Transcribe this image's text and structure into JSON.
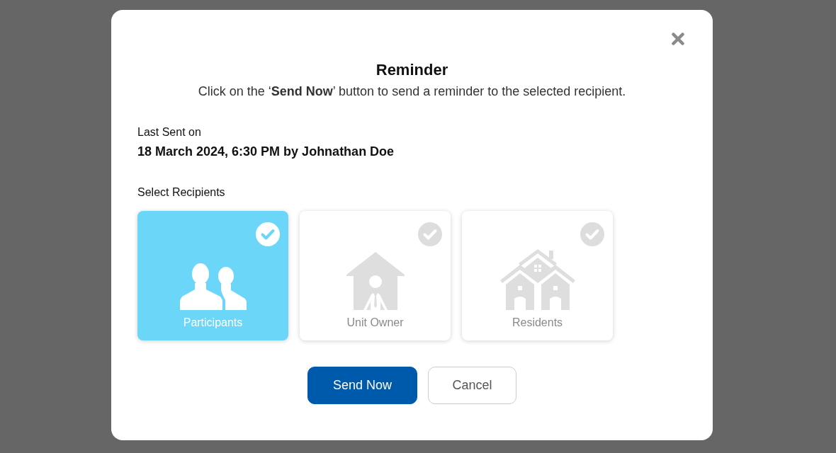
{
  "dialog": {
    "title": "Reminder",
    "instruction": "Click on the ‘**Send Now**’ button to send a reminder to the selected recipient.",
    "last_sent": {
      "label": "Last Sent on",
      "value": "18 March 2024, 6:30 PM by Johnathan Doe"
    },
    "recipients": {
      "label": "Select Recipients",
      "options": [
        {
          "label": "Participants",
          "kind": "participants",
          "selected": true
        },
        {
          "label": "Unit Owner",
          "kind": "owner",
          "selected": false
        },
        {
          "label": "Residents",
          "kind": "residents",
          "selected": false
        }
      ]
    },
    "buttons": [
      {
        "label": "Send Now",
        "kind": "primary"
      },
      {
        "label": "Cancel",
        "kind": "secondary"
      }
    ]
  }
}
